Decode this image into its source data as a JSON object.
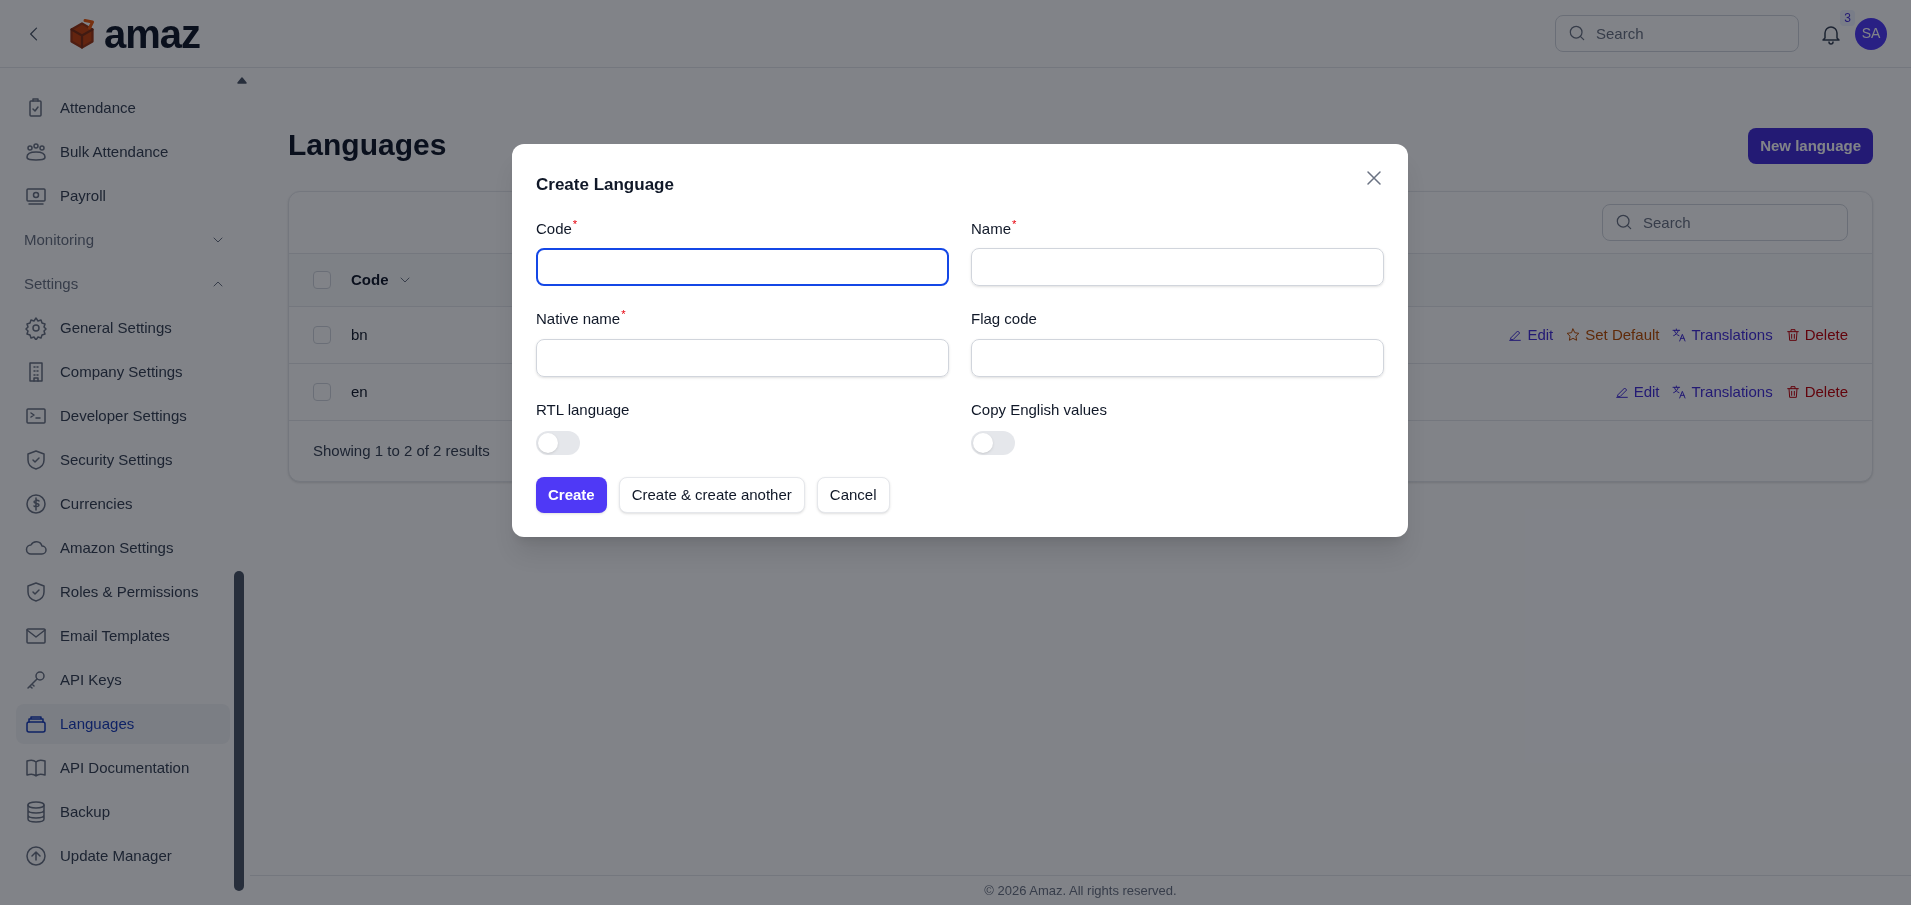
{
  "header": {
    "logo_text": "amaz",
    "search": {
      "placeholder": "Search"
    },
    "notifications": {
      "count": "3"
    },
    "avatar": {
      "initials": "SA"
    }
  },
  "sidebar": {
    "items": [
      {
        "kind": "item",
        "label": "Attendance",
        "selected": false
      },
      {
        "kind": "item",
        "label": "Bulk Attendance",
        "selected": false
      },
      {
        "kind": "item",
        "label": "Payroll",
        "selected": false
      },
      {
        "kind": "section",
        "label": "Monitoring",
        "expanded": false
      },
      {
        "kind": "section",
        "label": "Settings",
        "expanded": true
      },
      {
        "kind": "item",
        "label": "General Settings",
        "selected": false
      },
      {
        "kind": "item",
        "label": "Company Settings",
        "selected": false
      },
      {
        "kind": "item",
        "label": "Developer Settings",
        "selected": false
      },
      {
        "kind": "item",
        "label": "Security Settings",
        "selected": false
      },
      {
        "kind": "item",
        "label": "Currencies",
        "selected": false
      },
      {
        "kind": "item",
        "label": "Amazon Settings",
        "selected": false
      },
      {
        "kind": "item",
        "label": "Roles & Permissions",
        "selected": false
      },
      {
        "kind": "item",
        "label": "Email Templates",
        "selected": false
      },
      {
        "kind": "item",
        "label": "API Keys",
        "selected": false
      },
      {
        "kind": "item",
        "label": "Languages",
        "selected": true
      },
      {
        "kind": "item",
        "label": "API Documentation",
        "selected": false
      },
      {
        "kind": "item",
        "label": "Backup",
        "selected": false
      },
      {
        "kind": "item",
        "label": "Update Manager",
        "selected": false
      }
    ]
  },
  "page": {
    "title": "Languages",
    "new_button": "New language"
  },
  "table": {
    "search": {
      "placeholder": "Search"
    },
    "select_all": {
      "checked": false
    },
    "columns": [
      "Code"
    ],
    "rows": [
      {
        "code": "bn",
        "selected": false,
        "actions": [
          {
            "kind": "edit",
            "label": "Edit"
          },
          {
            "kind": "default",
            "label": "Set Default"
          },
          {
            "kind": "translations",
            "label": "Translations"
          },
          {
            "kind": "delete",
            "label": "Delete"
          }
        ]
      },
      {
        "code": "en",
        "selected": false,
        "actions": [
          {
            "kind": "edit",
            "label": "Edit"
          },
          {
            "kind": "translations",
            "label": "Translations"
          },
          {
            "kind": "delete",
            "label": "Delete"
          }
        ]
      }
    ],
    "summary": "Showing 1 to 2 of 2 results"
  },
  "modal": {
    "title": "Create Language",
    "fields": [
      {
        "kind": "text",
        "label": "Code",
        "marker": "*",
        "focused": true
      },
      {
        "kind": "text",
        "label": "Name",
        "marker": "*",
        "focused": false
      },
      {
        "kind": "text",
        "label": "Native name",
        "marker": "*",
        "focused": false
      },
      {
        "kind": "text",
        "label": "Flag code",
        "focused": false
      },
      {
        "kind": "toggle",
        "label": "RTL language",
        "on": false
      },
      {
        "kind": "toggle",
        "label": "Copy English values",
        "on": false
      }
    ],
    "buttons": [
      {
        "kind": "primary",
        "label": "Create"
      },
      {
        "kind": "secondary",
        "label": "Create & create another"
      },
      {
        "kind": "secondary",
        "label": "Cancel"
      }
    ]
  },
  "footer": {
    "text": "© 2026 Amaz. All rights reserved."
  }
}
